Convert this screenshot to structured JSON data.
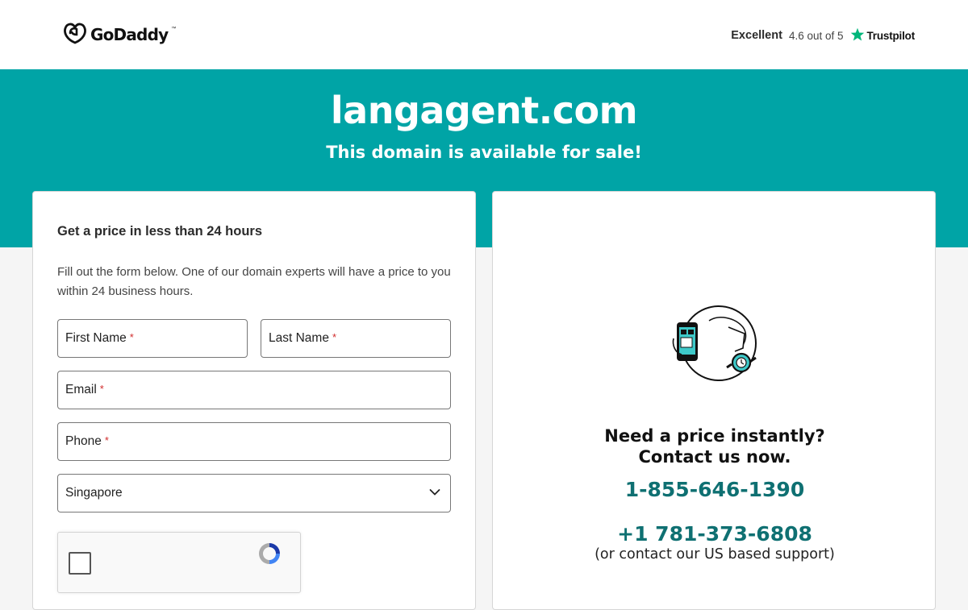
{
  "header": {
    "logo_text": "GoDaddy",
    "logo_tm": "™",
    "rating_word": "Excellent",
    "rating_score": "4.6 out of 5",
    "trustpilot_label": "Trustpilot"
  },
  "hero": {
    "domain": "langagent.com",
    "subtitle": "This domain is available for sale!"
  },
  "form": {
    "title": "Get a price in less than 24 hours",
    "description": "Fill out the form below. One of our domain experts will have a price to you within 24 business hours.",
    "first_name_label": "First Name",
    "last_name_label": "Last Name",
    "email_label": "Email",
    "phone_label": "Phone",
    "required_marker": "*",
    "country_value": "Singapore"
  },
  "contact": {
    "heading_line1": "Need a price instantly?",
    "heading_line2": "Contact us now.",
    "phone_primary": "1-855-646-1390",
    "phone_secondary": "+1 781-373-6808",
    "support_note": "(or contact our US based support)"
  },
  "colors": {
    "hero_teal": "#00a4a6",
    "phone_teal": "#0f7072",
    "trustpilot_green": "#00b67a",
    "required_red": "#d12c2c"
  },
  "icons": [
    "godaddy-logo-icon",
    "trustpilot-star-icon",
    "chevron-down-icon",
    "recaptcha-icon",
    "phone-clock-illustration"
  ]
}
